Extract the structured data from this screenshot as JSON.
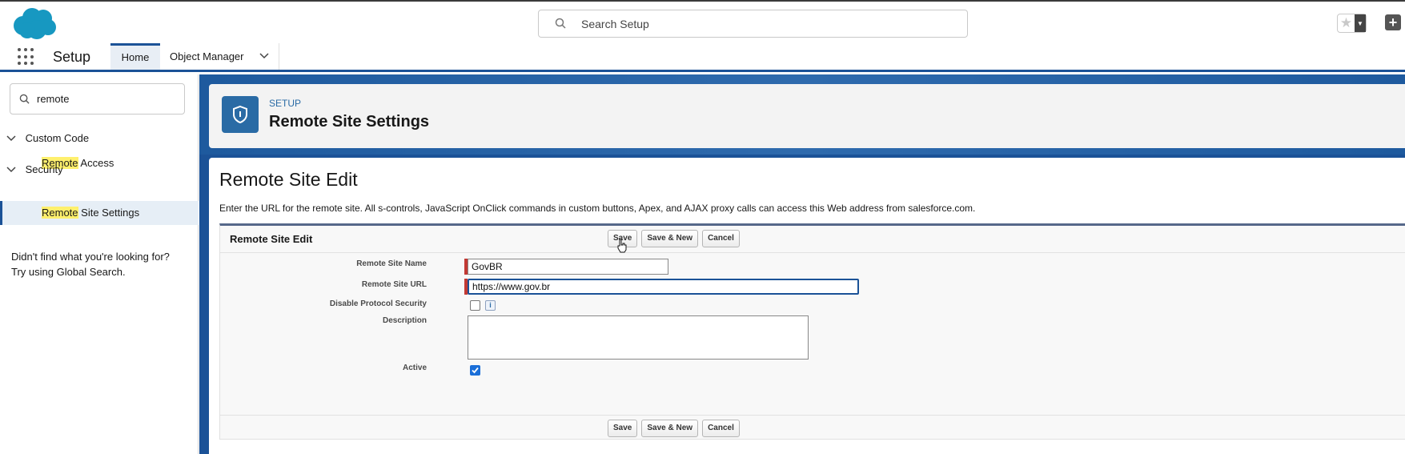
{
  "top": {
    "search_placeholder": "Search Setup",
    "logo_name": "cloud-logo",
    "favorite_icon": "star-icon",
    "add_icon": "plus-icon"
  },
  "nav": {
    "app_name": "Setup",
    "tabs": [
      {
        "label": "Home",
        "selected": true
      },
      {
        "label": "Object Manager",
        "selected": false
      }
    ]
  },
  "sidebar": {
    "quick_find_value": "remote",
    "groups": [
      {
        "label": "Custom Code",
        "items": [
          {
            "match": "Remote",
            "rest": " Access",
            "selected": false
          }
        ]
      },
      {
        "label": "Security",
        "items": [
          {
            "match": "Remote",
            "rest": " Site Settings",
            "selected": true
          }
        ]
      }
    ],
    "not_found_line1": "Didn't find what you're looking for?",
    "not_found_line2": "Try using Global Search."
  },
  "header": {
    "eyebrow": "SETUP",
    "title": "Remote Site Settings"
  },
  "page": {
    "title": "Remote Site Edit",
    "intro": "Enter the URL for the remote site. All s-controls, JavaScript OnClick commands in custom buttons, Apex, and AJAX proxy calls can access this Web address from salesforce.com."
  },
  "form": {
    "block_title": "Remote Site Edit",
    "buttons": {
      "save": "Save",
      "save_new": "Save & New",
      "cancel": "Cancel"
    },
    "fields": {
      "name_label": "Remote Site Name",
      "name_value": "GovBR",
      "url_label": "Remote Site URL",
      "url_value": "https://www.gov.br",
      "disable_label": "Disable Protocol Security",
      "disable_checked": false,
      "info_glyph": "i",
      "description_label": "Description",
      "description_value": "",
      "active_label": "Active",
      "active_checked": true
    }
  }
}
